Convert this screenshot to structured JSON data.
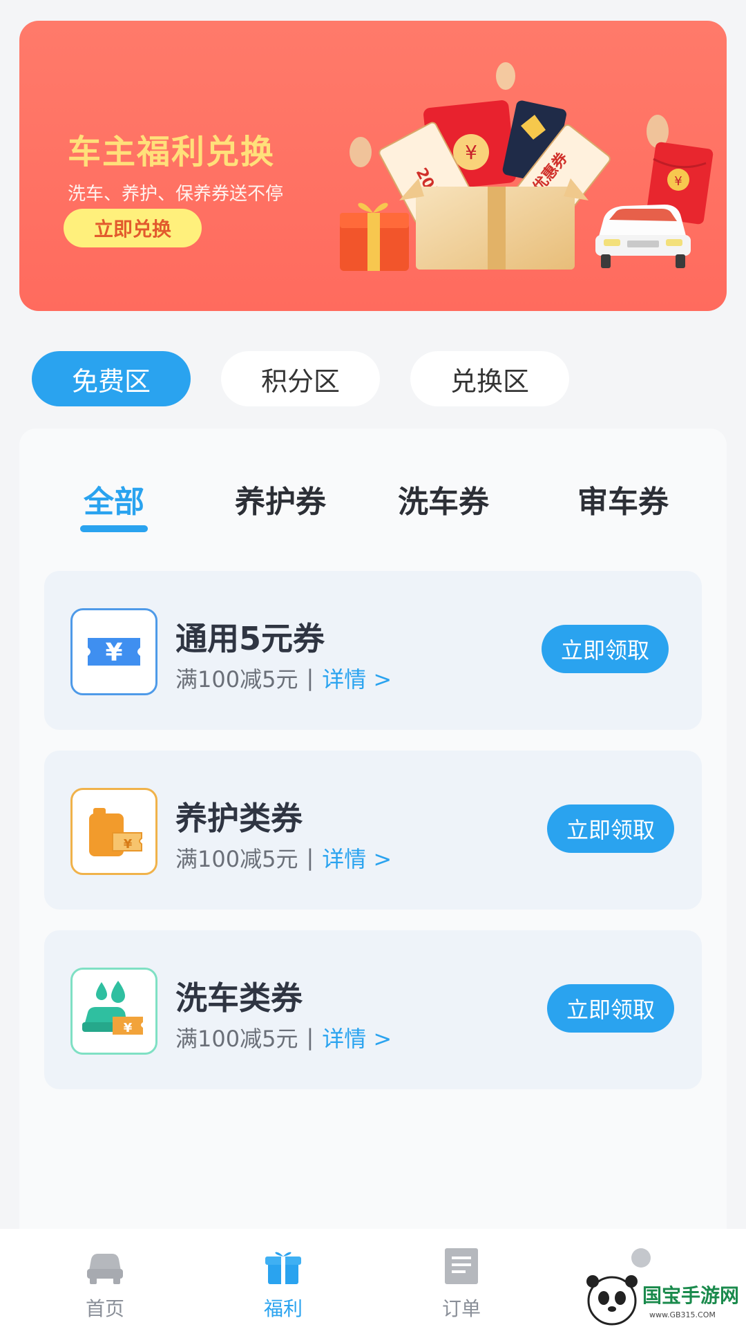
{
  "banner": {
    "title": "车主福利兑换",
    "subtitle": "洗车、养护、保养券送不停",
    "button_label": "立即兑换",
    "art_labels": {
      "voucher_left": "20元 优惠",
      "voucher_right": "优惠券",
      "currency": "¥"
    }
  },
  "zones": [
    {
      "label": "免费区",
      "active": true
    },
    {
      "label": "积分区",
      "active": false
    },
    {
      "label": "兑换区",
      "active": false
    }
  ],
  "categories": [
    {
      "label": "全部",
      "active": true
    },
    {
      "label": "养护券",
      "active": false
    },
    {
      "label": "洗车券",
      "active": false
    },
    {
      "label": "审车券",
      "active": false
    }
  ],
  "coupons": [
    {
      "title": "通用5元券",
      "condition": "满100减5元",
      "separator": "|",
      "detail": "详情 >",
      "button": "立即领取",
      "icon": "ticket-yuan-icon"
    },
    {
      "title": "养护类券",
      "condition": "满100减5元",
      "separator": "|",
      "detail": "详情 >",
      "button": "立即领取",
      "icon": "oil-can-coupon-icon"
    },
    {
      "title": "洗车类券",
      "condition": "满100减5元",
      "separator": "|",
      "detail": "详情 >",
      "button": "立即领取",
      "icon": "car-wash-coupon-icon"
    }
  ],
  "nav": [
    {
      "label": "首页",
      "icon": "car-icon",
      "active": false
    },
    {
      "label": "福利",
      "icon": "gift-icon",
      "active": true
    },
    {
      "label": "订单",
      "icon": "document-icon",
      "active": false
    }
  ],
  "watermark": {
    "brand": "国宝手游网",
    "url": "www.GB315.COM"
  },
  "colors": {
    "accent": "#2aa3ef",
    "banner": "#ff6b5e",
    "banner_title": "#ffe07a",
    "banner_button": "#fff07c"
  }
}
